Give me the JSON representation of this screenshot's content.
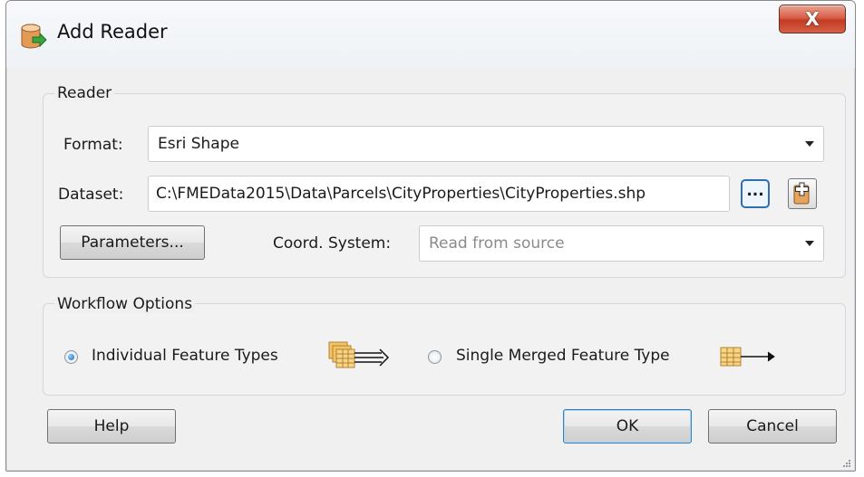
{
  "window": {
    "title": "Add Reader",
    "close_symbol": "X"
  },
  "reader_group": {
    "legend": "Reader",
    "format_label": "Format:",
    "format_value": "Esri Shape",
    "dataset_label": "Dataset:",
    "dataset_value": "C:\\FMEData2015\\Data\\Parcels\\CityProperties\\CityProperties.shp",
    "browse_label": "...",
    "parameters_label": "Parameters...",
    "coord_label": "Coord. System:",
    "coord_value": "Read from source"
  },
  "workflow_group": {
    "legend": "Workflow Options",
    "option_individual": "Individual Feature Types",
    "option_merged": "Single Merged Feature Type",
    "selected": "Individual Feature Types"
  },
  "footer": {
    "help_label": "Help",
    "ok_label": "OK",
    "cancel_label": "Cancel"
  },
  "icons": {
    "app": "database-add-icon",
    "close": "close-icon",
    "browse": "ellipsis-icon",
    "add_dataset": "add-file-icon",
    "individual": "stacked-tables-arrow-icon",
    "merged": "table-arrow-icon"
  },
  "colors": {
    "close_button": "#c23b22",
    "accent": "#1565c0"
  }
}
